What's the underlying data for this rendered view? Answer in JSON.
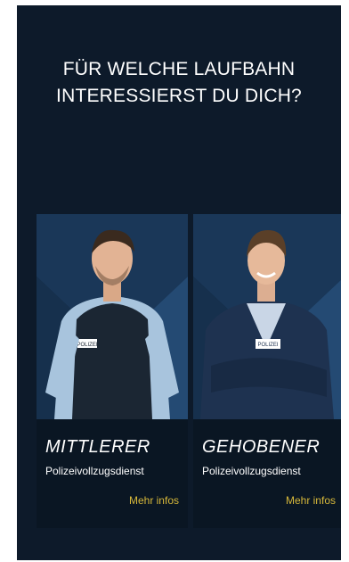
{
  "heading": {
    "line1": "FÜR WELCHE LAUFBAHN",
    "line2": "INTERESSIERST DU DICH?"
  },
  "cards": [
    {
      "title": "MITTLERER",
      "subtitle": "Polizeivollzugsdienst",
      "link": "Mehr infos",
      "badge": "POLIZEI"
    },
    {
      "title": "GEHOBENER",
      "subtitle": "Polizeivollzugsdienst",
      "link": "Mehr infos",
      "badge": "POLIZEI"
    }
  ],
  "colors": {
    "background": "#0d1a2a",
    "card": "#0a1623",
    "accent_blue": "#1f3f64",
    "link": "#d7b83a",
    "text": "#ffffff"
  }
}
